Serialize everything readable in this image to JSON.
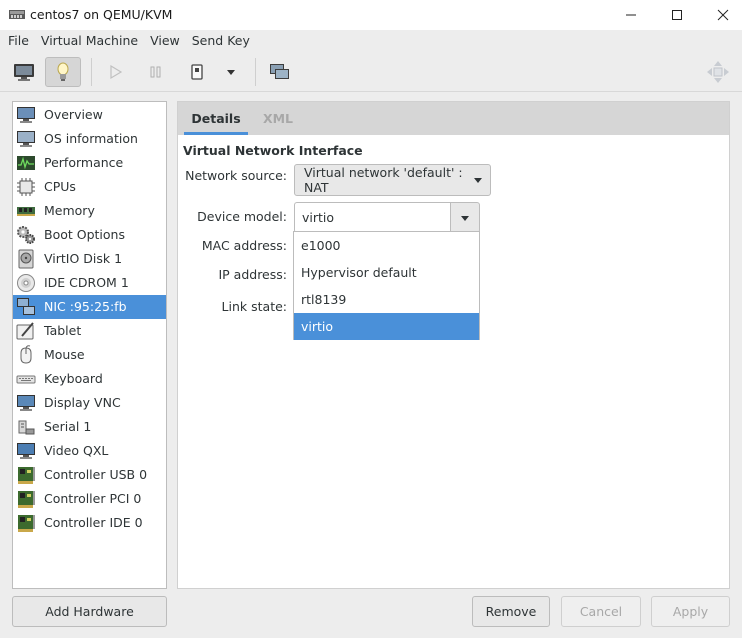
{
  "window": {
    "title": "centos7 on QEMU/KVM"
  },
  "menu": [
    "File",
    "Virtual Machine",
    "View",
    "Send Key"
  ],
  "toolbar": {
    "icons": [
      "monitor-icon",
      "lightbulb-icon",
      "play-icon",
      "pause-icon",
      "power-icon",
      "dropdown-arrow-icon",
      "screenshot-icon",
      "fullscreen-icon"
    ]
  },
  "sidebar": {
    "items": [
      {
        "label": "Overview",
        "icon": "overview-monitor-icon"
      },
      {
        "label": "OS information",
        "icon": "os-information-icon"
      },
      {
        "label": "Performance",
        "icon": "performance-graph-icon"
      },
      {
        "label": "CPUs",
        "icon": "cpu-chip-icon"
      },
      {
        "label": "Memory",
        "icon": "memory-module-icon"
      },
      {
        "label": "Boot Options",
        "icon": "boot-gears-icon"
      },
      {
        "label": "VirtIO Disk 1",
        "icon": "disk-drive-icon"
      },
      {
        "label": "IDE CDROM 1",
        "icon": "cdrom-icon"
      },
      {
        "label": "NIC :95:25:fb",
        "icon": "network-card-icon"
      },
      {
        "label": "Tablet",
        "icon": "tablet-pen-icon"
      },
      {
        "label": "Mouse",
        "icon": "mouse-icon"
      },
      {
        "label": "Keyboard",
        "icon": "keyboard-icon"
      },
      {
        "label": "Display VNC",
        "icon": "display-monitor-icon"
      },
      {
        "label": "Serial 1",
        "icon": "serial-port-icon"
      },
      {
        "label": "Video QXL",
        "icon": "video-monitor-icon"
      },
      {
        "label": "Controller USB 0",
        "icon": "controller-card-icon"
      },
      {
        "label": "Controller PCI 0",
        "icon": "controller-card-icon"
      },
      {
        "label": "Controller IDE 0",
        "icon": "controller-card-icon"
      }
    ],
    "selected_index": 8
  },
  "tabs": {
    "details": "Details",
    "xml": "XML"
  },
  "nic": {
    "section_title": "Virtual Network Interface",
    "network_source_label": "Network source:",
    "network_source_value": "Virtual network 'default' : NAT",
    "device_model_label": "Device model:",
    "device_model_value": "virtio",
    "mac_label": "MAC address:",
    "ip_label": "IP address:",
    "link_label": "Link state:",
    "model_options": [
      "e1000",
      "Hypervisor default",
      "rtl8139",
      "virtio"
    ],
    "selected_option_index": 3
  },
  "buttons": {
    "add_hardware": "Add Hardware",
    "remove": "Remove",
    "cancel": "Cancel",
    "apply": "Apply"
  },
  "colors": {
    "accent": "#4a90d9",
    "window_bg": "#ededed",
    "tab_bar": "#d6d6d6"
  }
}
